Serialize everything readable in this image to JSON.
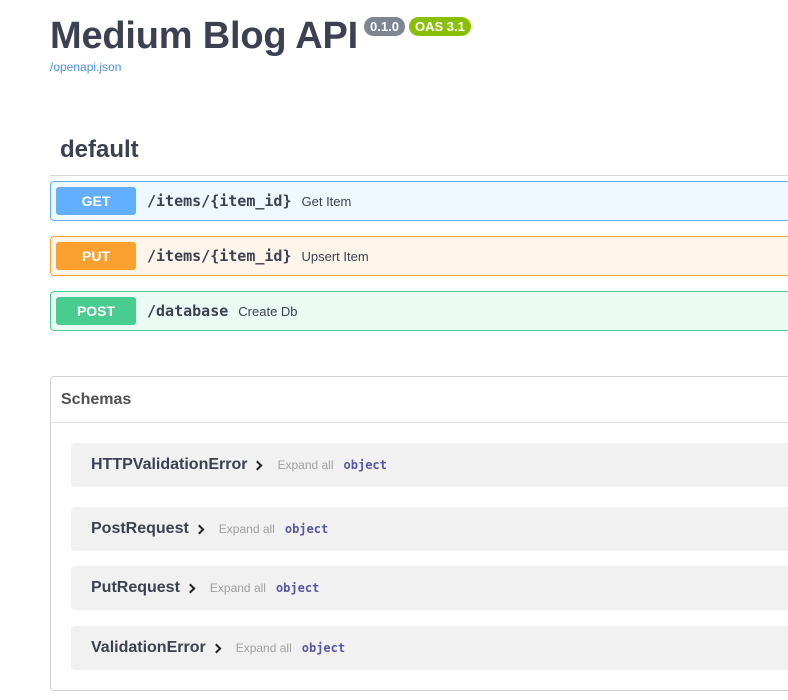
{
  "header": {
    "title": "Medium Blog API",
    "version_badge": "0.1.0",
    "oas_badge": "OAS 3.1",
    "spec_link": "/openapi.json"
  },
  "section": {
    "title": "default"
  },
  "operations": [
    {
      "method": "GET",
      "path": "/items/{item_id}",
      "summary": "Get Item"
    },
    {
      "method": "PUT",
      "path": "/items/{item_id}",
      "summary": "Upsert Item"
    },
    {
      "method": "POST",
      "path": "/database",
      "summary": "Create Db"
    }
  ],
  "schemas": {
    "title": "Schemas",
    "models": [
      {
        "name": "HTTPValidationError",
        "expand": "Expand all",
        "type": "object"
      },
      {
        "name": "PostRequest",
        "expand": "Expand all",
        "type": "object"
      },
      {
        "name": "PutRequest",
        "expand": "Expand all",
        "type": "object"
      },
      {
        "name": "ValidationError",
        "expand": "Expand all",
        "type": "object"
      }
    ]
  },
  "icons": {
    "model_toggle": "chevron-right-icon"
  },
  "colors": {
    "get": "#61affe",
    "put": "#fca130",
    "post": "#49cc90",
    "version_badge": "#7d8492",
    "oas_badge": "#89bf04",
    "link": "#4990e2"
  }
}
